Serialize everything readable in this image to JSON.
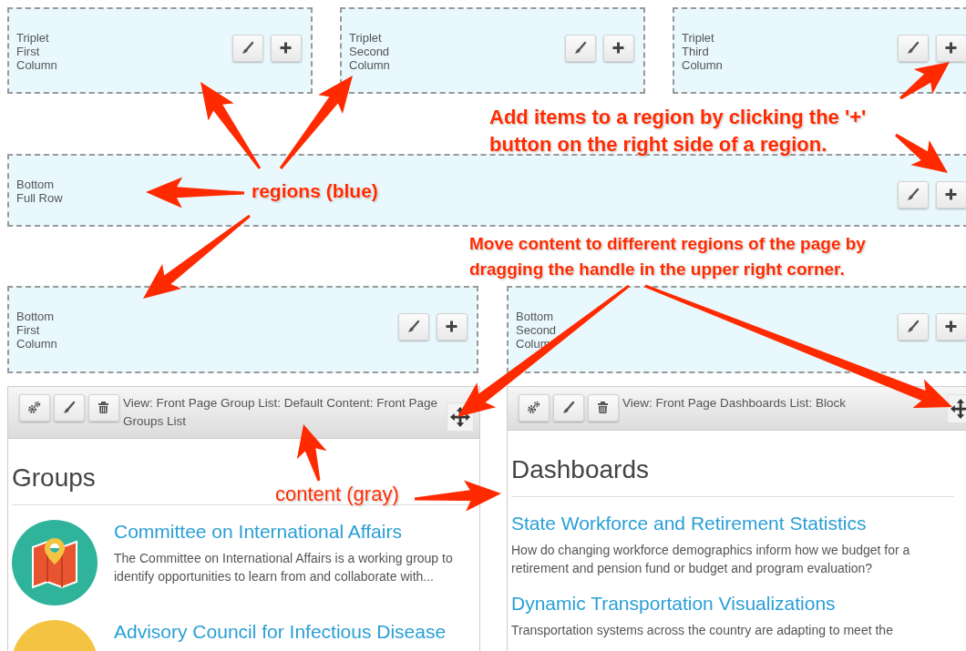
{
  "region_rows": [
    {
      "regions": [
        {
          "label": "Triplet First Column",
          "buttons": [
            {
              "kind": "style"
            },
            {
              "kind": "add"
            }
          ]
        },
        {
          "label": "Triplet Second Column",
          "buttons": [
            {
              "kind": "style"
            },
            {
              "kind": "add"
            }
          ]
        },
        {
          "label": "Triplet Third Column",
          "buttons": [
            {
              "kind": "style"
            },
            {
              "kind": "add"
            }
          ]
        }
      ]
    },
    {
      "regions": [
        {
          "label": "Bottom Full Row",
          "buttons": [
            {
              "kind": "style"
            },
            {
              "kind": "add"
            }
          ]
        }
      ]
    },
    {
      "regions": [
        {
          "label": "Bottom First Column",
          "buttons": [
            {
              "kind": "style"
            },
            {
              "kind": "add"
            }
          ]
        },
        {
          "label": "Bottom Second Colum",
          "buttons": [
            {
              "kind": "style"
            },
            {
              "kind": "add"
            }
          ]
        }
      ]
    }
  ],
  "panels": [
    {
      "title": "View: Front Page Group List: Default Content: Front Page Groups List",
      "tools": [
        {
          "kind": "settings"
        },
        {
          "kind": "style"
        },
        {
          "kind": "delete"
        }
      ],
      "heading": "Groups",
      "items": [
        {
          "title": "Committee on International Affairs",
          "description": "The Committee on International Affairs is a working group to identify opportunities to learn from and collaborate with...",
          "color": "#2fb39a"
        },
        {
          "title": "Advisory Council for Infectious Disease",
          "color": "#f5c342"
        }
      ]
    },
    {
      "title": "View: Front Page Dashboards List: Block",
      "tools": [
        {
          "kind": "settings"
        },
        {
          "kind": "style"
        },
        {
          "kind": "delete"
        }
      ],
      "heading": "Dashboards",
      "items": [
        {
          "title": "State Workforce and Retirement Statistics",
          "description": "How do changing workforce demographics inform how we budget for a retirement and pension fund or budget and program evaluation?"
        },
        {
          "title": "Dynamic Transportation Visualizations",
          "description": "Transportation systems across the country are adapting to meet the"
        }
      ]
    }
  ],
  "annotations": [
    {
      "kind": "heavy",
      "text": "Add items to a region by clicking the '+' button on the right side of a region."
    },
    {
      "kind": "heavy",
      "text": "regions (blue)"
    },
    {
      "kind": "heavy",
      "text": "Move content to different regions of the page by dragging the handle in the upper right corner."
    },
    {
      "kind": "light",
      "text": "content (gray)"
    }
  ]
}
